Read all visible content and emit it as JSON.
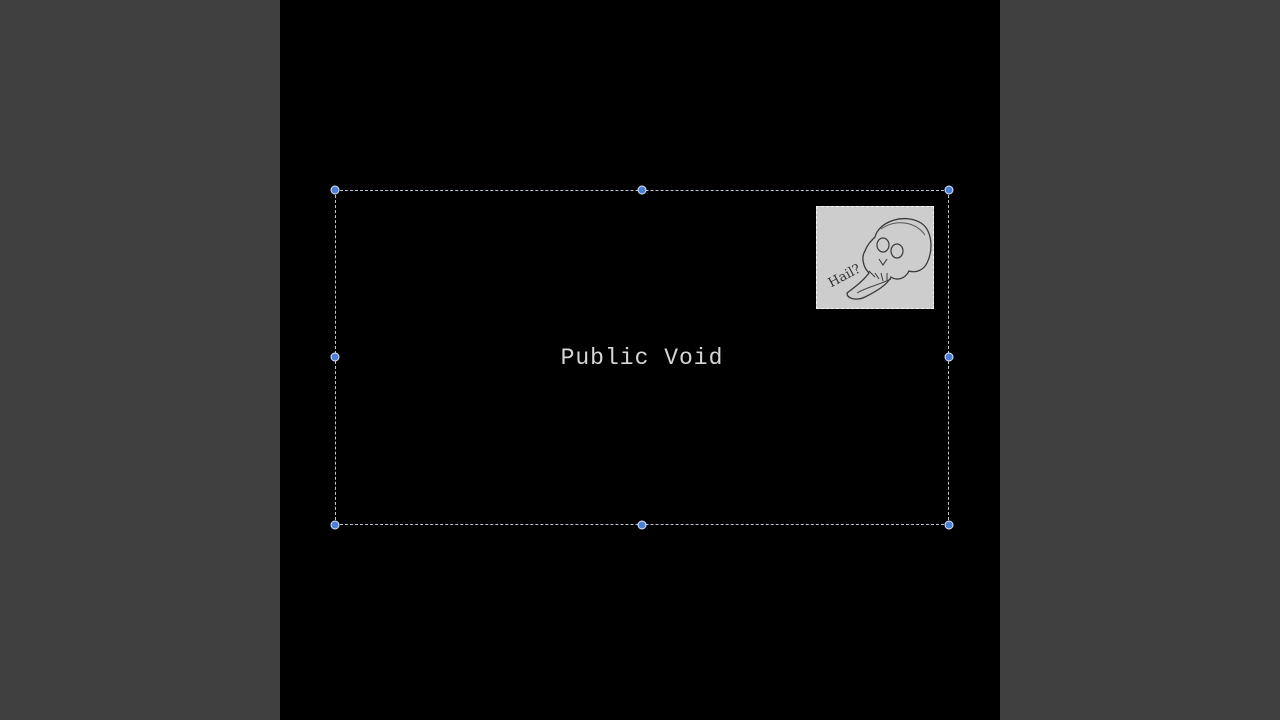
{
  "envelope": {
    "address_text": "Public Void"
  },
  "stamp": {
    "handwriting": "Hail?",
    "image": "skull-sketch-stamp"
  },
  "selection": {
    "handle_color": "#4a7fd6",
    "border_color": "#b9c4d4"
  },
  "colors": {
    "canvas": "#000000",
    "workspace": "#404040",
    "text": "#d6d6d6",
    "stamp_paper": "#cfcfcf"
  }
}
